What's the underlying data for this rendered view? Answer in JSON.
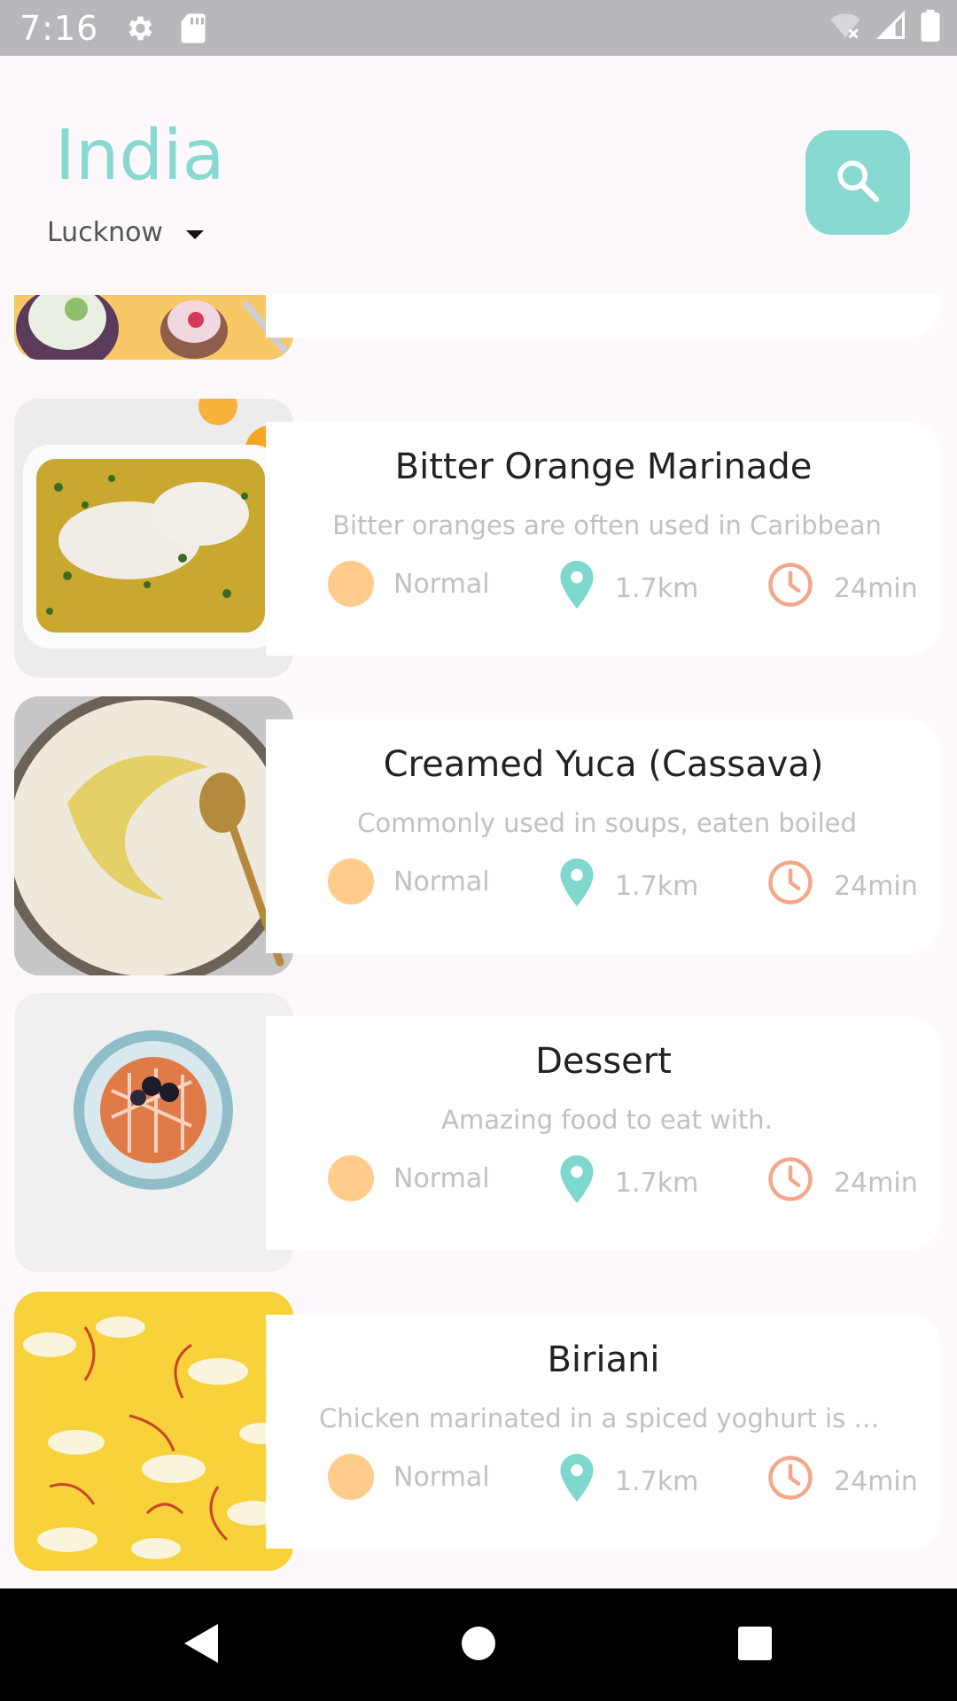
{
  "status_bar": {
    "time": "7:16",
    "icons": [
      "gear-icon",
      "sd-card-icon",
      "wifi-off-icon",
      "signal-icon",
      "battery-icon"
    ]
  },
  "header": {
    "country": "India",
    "city": "Lucknow",
    "search_icon": "search-icon"
  },
  "colors": {
    "accent": "#88d9d1",
    "level_dot": "#ffcc8c",
    "clock": "#f4a88a",
    "pin": "#7fd8cd",
    "muted_text": "#c4bfc1"
  },
  "items": [
    {
      "name": "",
      "description": "",
      "level": "",
      "distance": "",
      "time": ""
    },
    {
      "name": "Bitter Orange Marinade",
      "description": "Bitter oranges are often used in Caribbean",
      "level": "Normal",
      "distance": "1.7km",
      "time": "24min"
    },
    {
      "name": "Creamed Yuca (Cassava)",
      "description": "Commonly used in soups, eaten boiled",
      "level": "Normal",
      "distance": "1.7km",
      "time": "24min"
    },
    {
      "name": "Dessert",
      "description": "Amazing food to eat with.",
      "level": "Normal",
      "distance": "1.7km",
      "time": "24min"
    },
    {
      "name": "Biriani",
      "description": "Chicken marinated in a spiced yoghurt is placed in a large pot",
      "level": "Normal",
      "distance": "1.7km",
      "time": "24min"
    }
  ]
}
